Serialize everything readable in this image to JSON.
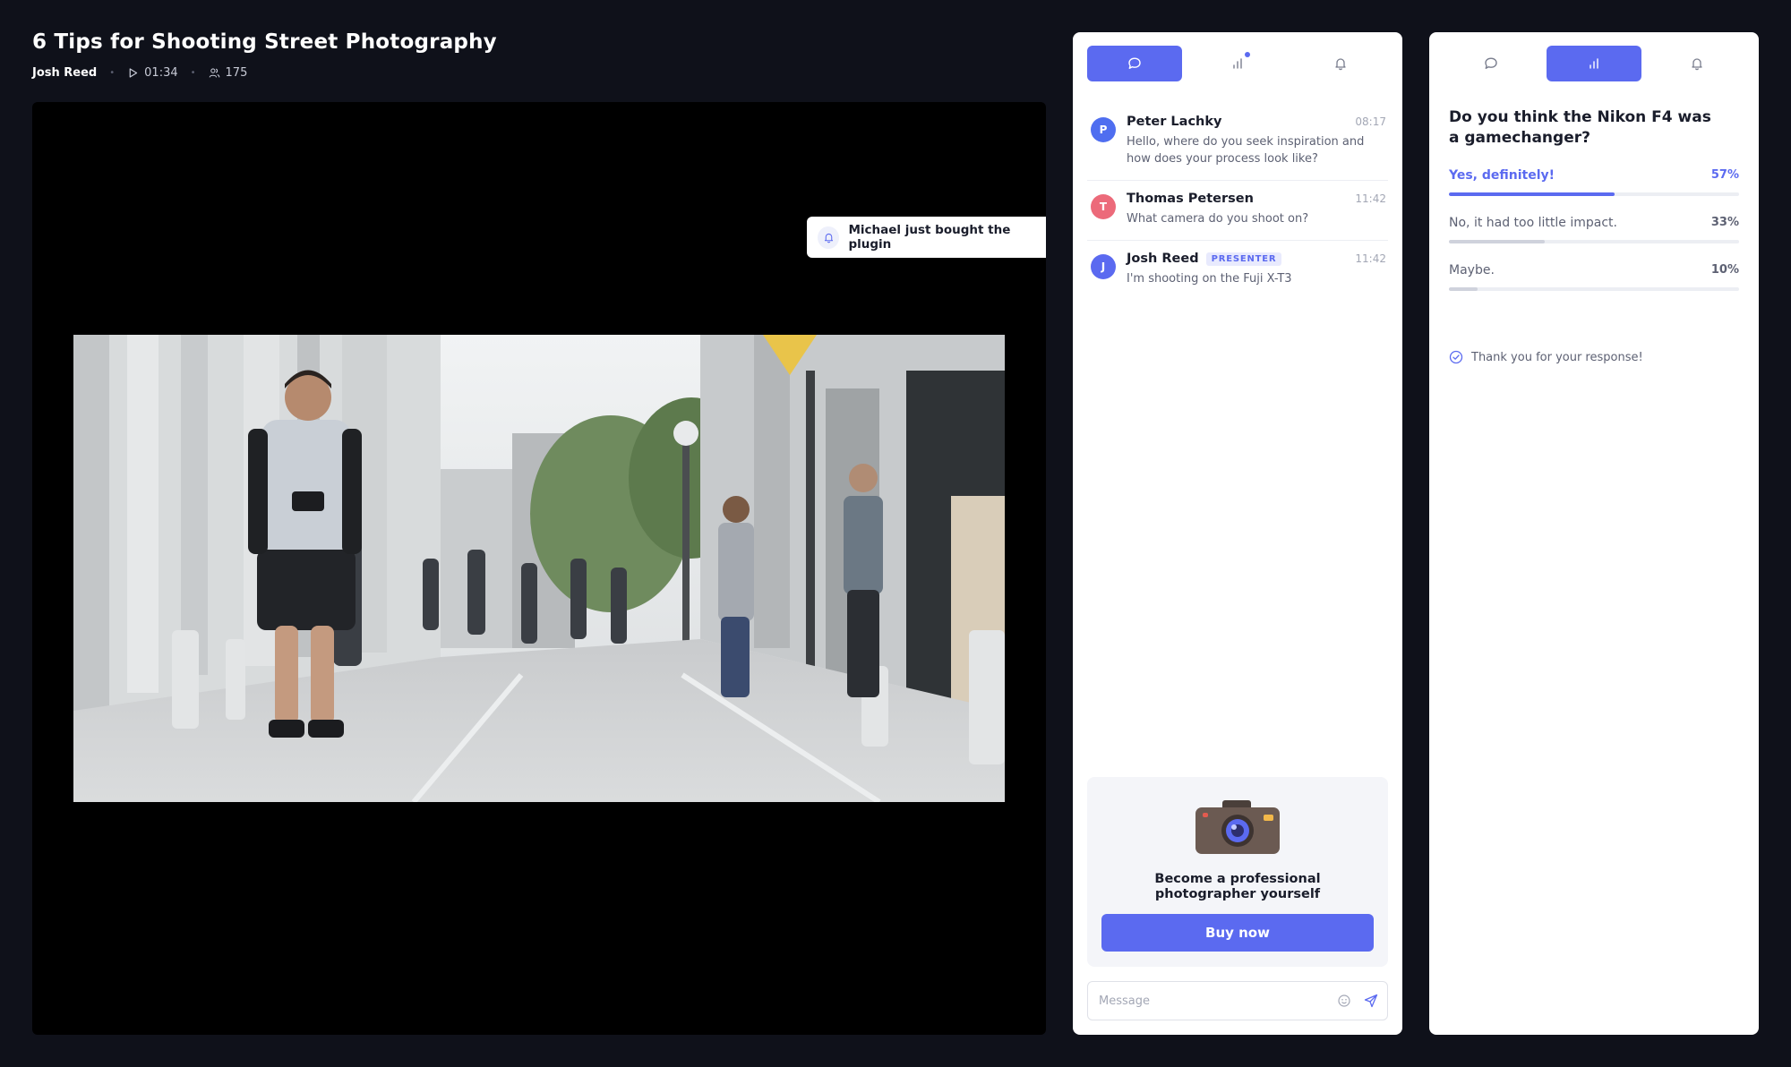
{
  "header": {
    "title": "6 Tips for Shooting Street Photography",
    "author": "Josh Reed",
    "duration": "01:34",
    "viewers": "175"
  },
  "notification": {
    "text": "Michael just bought the plugin"
  },
  "chat_panel": {
    "tabs": [
      {
        "icon": "chat-icon",
        "active": true
      },
      {
        "icon": "poll-icon",
        "active": false,
        "has_notification": true
      },
      {
        "icon": "bell-icon",
        "active": false
      }
    ],
    "messages": [
      {
        "initial": "P",
        "name": "Peter Lachky",
        "time": "08:17",
        "text": "Hello, where do you seek inspiration and how does your process look like?",
        "avatar_color": "#4f6ef0"
      },
      {
        "initial": "T",
        "name": "Thomas Petersen",
        "time": "11:42",
        "text": "What camera do you shoot on?",
        "avatar_color": "#ec6a7a"
      },
      {
        "initial": "J",
        "name": "Josh Reed",
        "badge": "PRESENTER",
        "time": "11:42",
        "text": "I'm shooting on the Fuji X-T3",
        "avatar_color": "#5b6af0"
      }
    ],
    "promo": {
      "title": "Become a professional photographer yourself",
      "button": "Buy now"
    },
    "composer": {
      "placeholder": "Message",
      "value": ""
    }
  },
  "poll_panel": {
    "tabs": [
      {
        "icon": "chat-icon",
        "active": false
      },
      {
        "icon": "poll-icon",
        "active": true
      },
      {
        "icon": "bell-icon",
        "active": false
      }
    ],
    "question": "Do you think the Nikon F4 was a gamechanger?",
    "options": [
      {
        "label": "Yes, definitely!",
        "percent": "57%",
        "value": 57,
        "selected": true
      },
      {
        "label": "No, it had too little impact.",
        "percent": "33%",
        "value": 33,
        "selected": false
      },
      {
        "label": "Maybe.",
        "percent": "10%",
        "value": 10,
        "selected": false
      }
    ],
    "thanks": "Thank you for your response!"
  },
  "colors": {
    "background": "#0f111a",
    "accent": "#5b6af0",
    "panel": "#ffffff"
  }
}
